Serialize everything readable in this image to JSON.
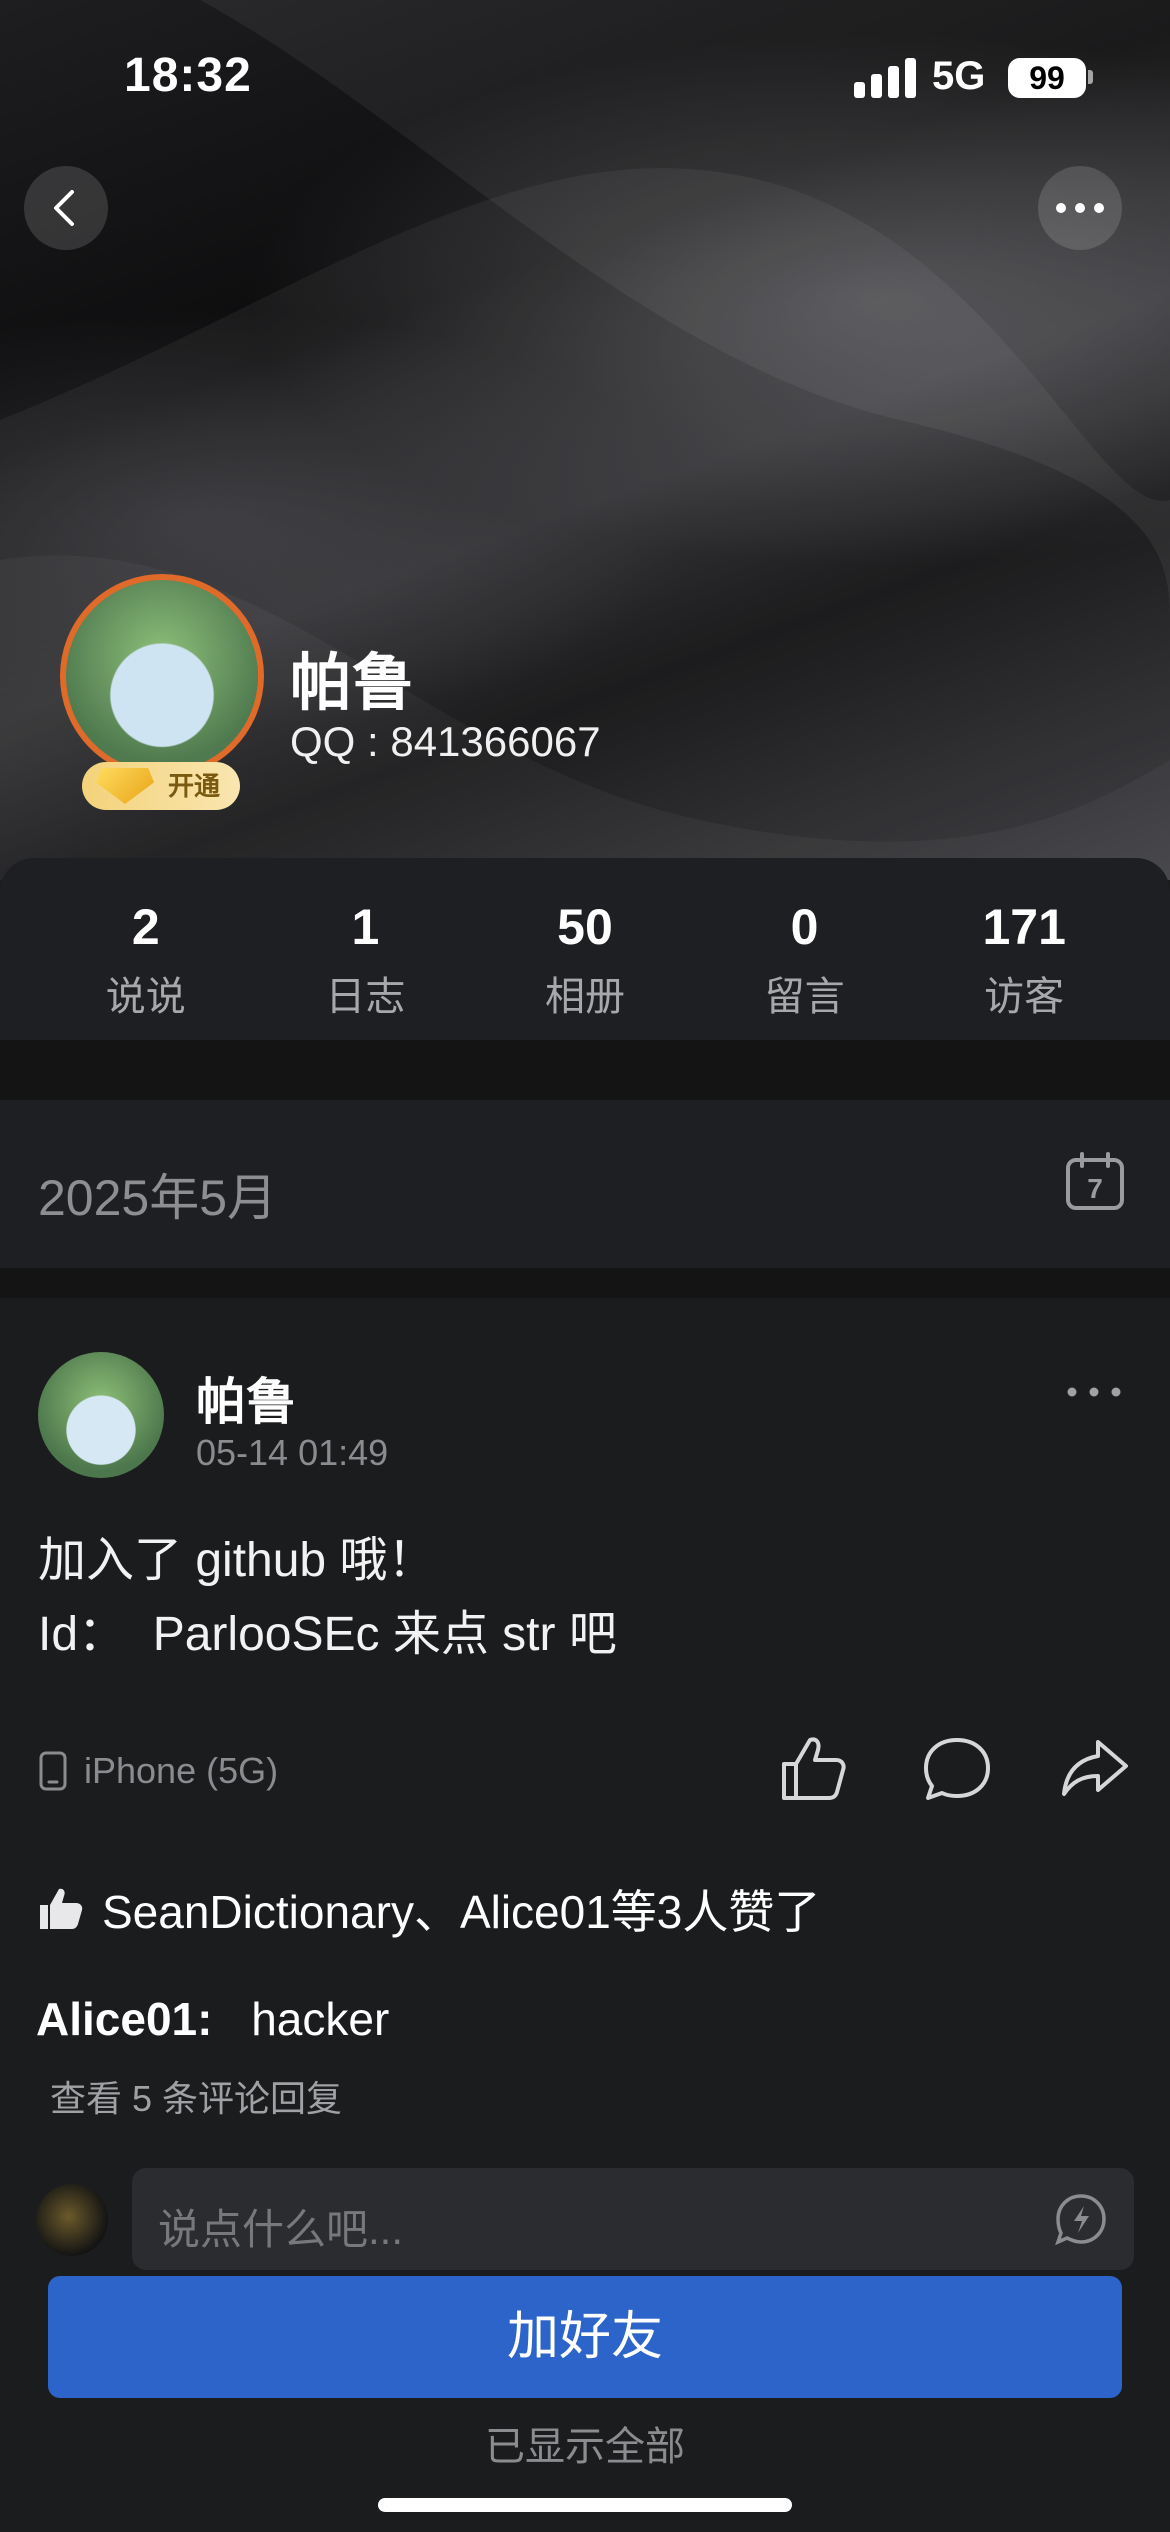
{
  "status_bar": {
    "time": "18:32",
    "network": "5G",
    "battery": "99"
  },
  "profile": {
    "name": "帕鲁",
    "qq": "QQ : 841366067",
    "vip_badge": "开通"
  },
  "stats": [
    {
      "value": "2",
      "label": "说说"
    },
    {
      "value": "1",
      "label": "日志"
    },
    {
      "value": "50",
      "label": "相册"
    },
    {
      "value": "0",
      "label": "留言"
    },
    {
      "value": "171",
      "label": "访客"
    }
  ],
  "month": {
    "label": "2025年5月",
    "calendar_day": "7"
  },
  "post": {
    "author": "帕鲁",
    "time": "05-14 01:49",
    "text": "加入了 github 哦！\nId：  ParlooSEc 来点 str 吧",
    "device": "iPhone (5G)",
    "likes": "SeanDictionary、Alice01等3人赞了",
    "comment": {
      "author": "Alice01:",
      "text": "hacker"
    },
    "view_replies": "查看 5 条评论回复",
    "input_placeholder": "说点什么吧..."
  },
  "add_friend_label": "加好友",
  "footer": "已显示全部",
  "colors": {
    "accent": "#2d64c9",
    "background": "#1b1c1e",
    "panel": "#1e1f22"
  }
}
